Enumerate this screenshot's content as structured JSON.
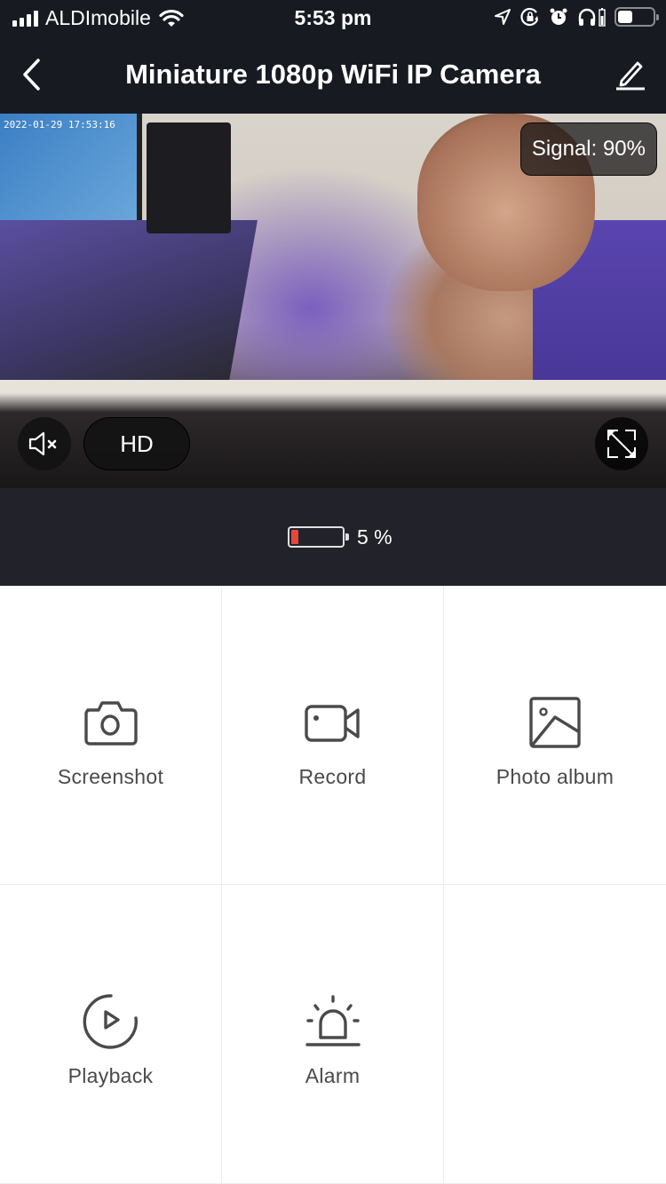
{
  "status_bar": {
    "carrier": "ALDImobile",
    "time": "5:53 pm",
    "icons": [
      "signal-bars-icon",
      "wifi-icon",
      "location-arrow-icon",
      "orientation-lock-icon",
      "alarm-clock-icon",
      "headphones-icon",
      "headphone-battery-icon",
      "battery-icon"
    ]
  },
  "nav": {
    "title": "Miniature 1080p WiFi IP Camera",
    "back_icon": "chevron-left-icon",
    "edit_icon": "pencil-icon"
  },
  "video": {
    "timestamp": "2022-01-29 17:53:16",
    "signal_label": "Signal: 90%",
    "signal_percent": 90,
    "quality_label": "HD",
    "mute_icon": "speaker-muted-icon",
    "fullscreen_icon": "expand-icon"
  },
  "camera_battery": {
    "level_percent": 5,
    "label": "5 %",
    "fill_color": "#e8453c"
  },
  "actions": [
    {
      "label": "Screenshot",
      "icon": "camera-icon"
    },
    {
      "label": "Record",
      "icon": "video-camera-icon"
    },
    {
      "label": "Photo album",
      "icon": "image-icon"
    },
    {
      "label": "Playback",
      "icon": "playback-icon"
    },
    {
      "label": "Alarm",
      "icon": "siren-icon"
    }
  ],
  "colors": {
    "header_bg": "#181a22",
    "battery_strip_bg": "#22232a",
    "icon_color": "#4a4a4a"
  }
}
